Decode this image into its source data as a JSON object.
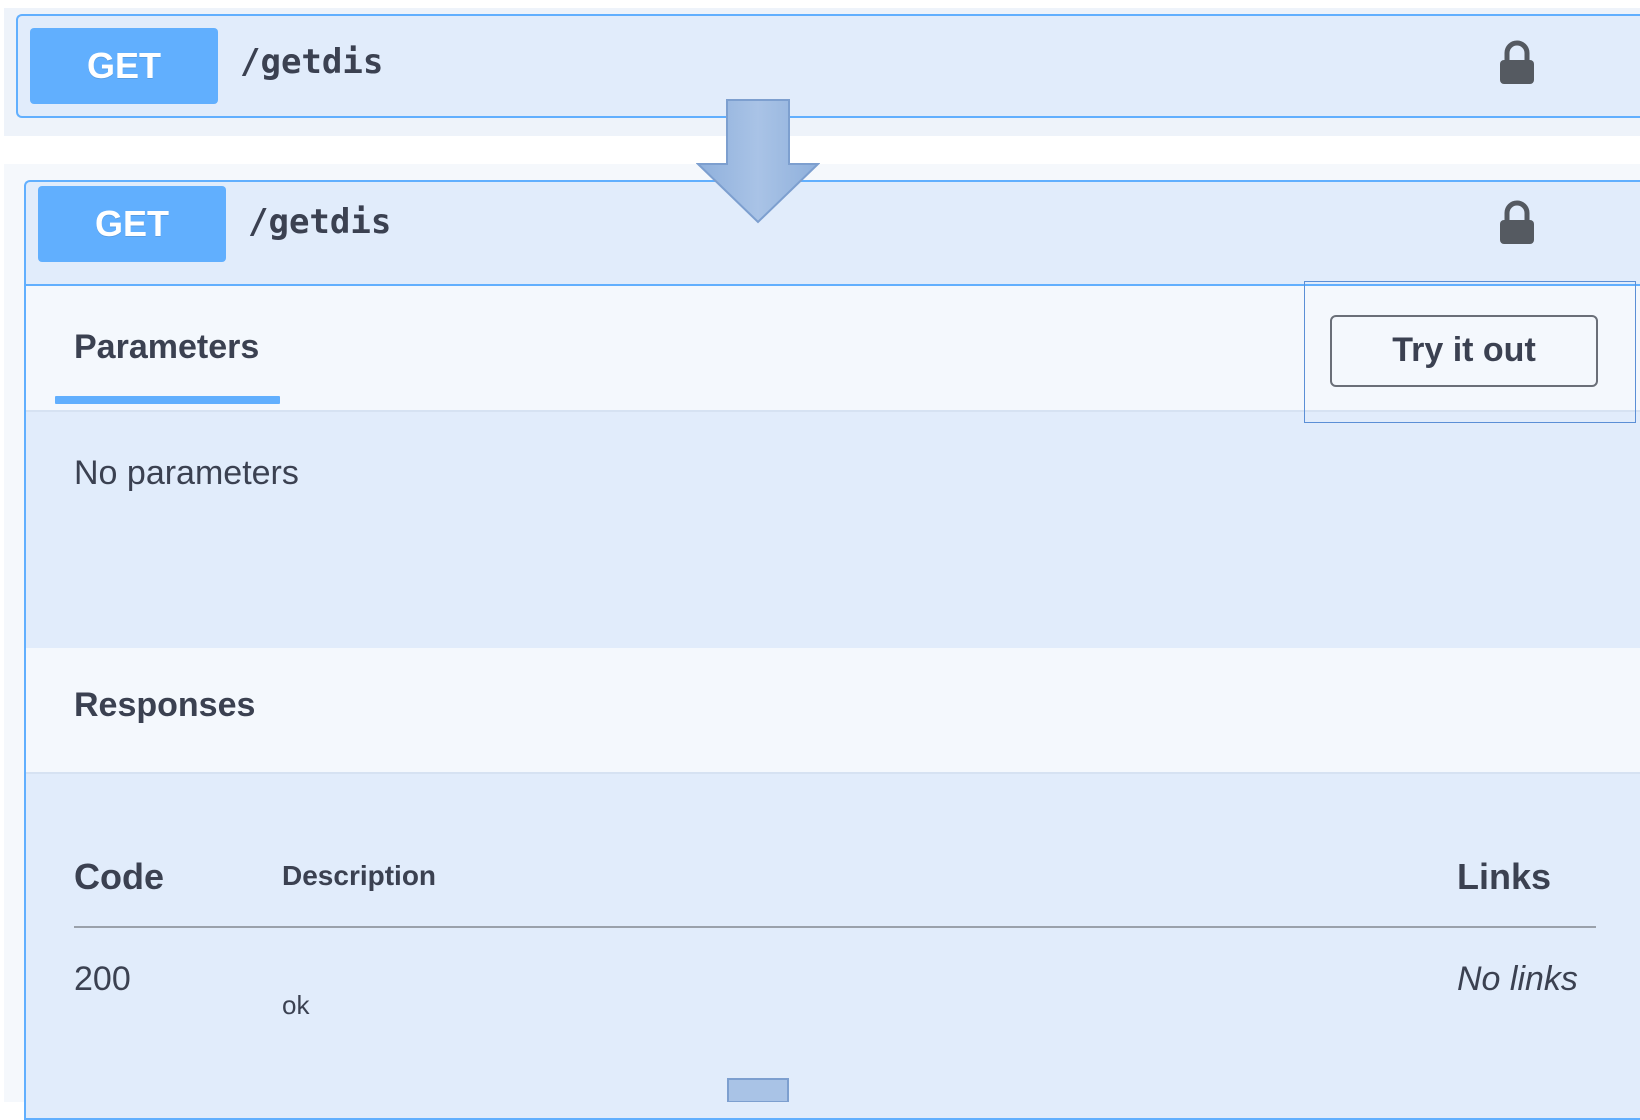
{
  "collapsed_operation": {
    "method": "GET",
    "path": "/getdis",
    "lock_icon": "lock-icon"
  },
  "expanded_operation": {
    "method": "GET",
    "path": "/getdis",
    "lock_icon": "lock-icon",
    "parameters": {
      "tab_label": "Parameters",
      "try_button_label": "Try it out",
      "empty_text": "No parameters"
    },
    "responses": {
      "title": "Responses",
      "columns": [
        "Code",
        "Description",
        "Links"
      ],
      "rows": [
        {
          "code": "200",
          "description": "ok",
          "links": "No links"
        }
      ]
    }
  },
  "annotation": {
    "arrow_icon": "down-arrow-icon",
    "arrow_color": "#9ebbe2",
    "highlight_color": "#5b8fd6"
  },
  "colors": {
    "get_method": "#61affe",
    "panel_bg": "#e1ecfb",
    "text": "#3b4151"
  }
}
